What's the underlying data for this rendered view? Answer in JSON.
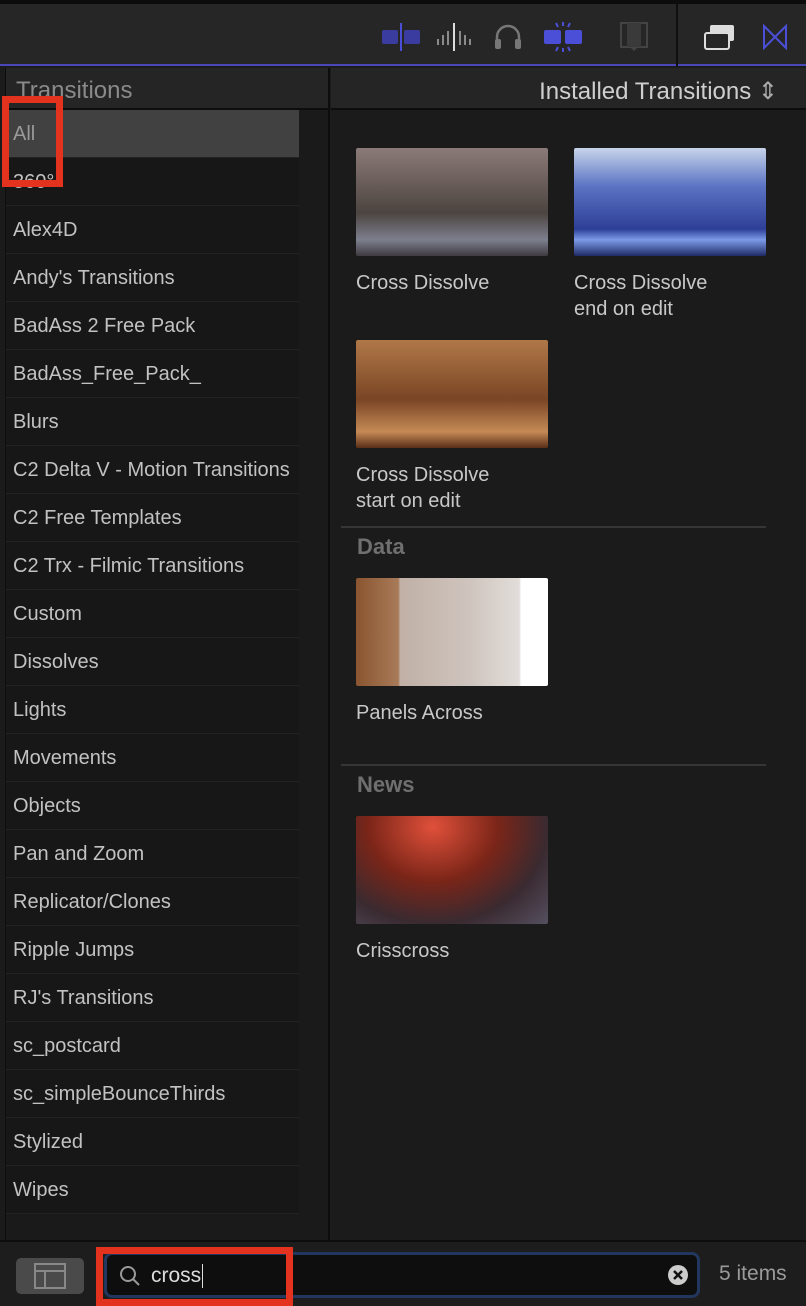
{
  "toolbar": {
    "icons": [
      "clip-connect-icon",
      "audio-waveform-icon",
      "headphones-icon",
      "snapping-icon",
      "filmstrip-icon",
      "window-layout-icon",
      "transitions-browser-icon"
    ],
    "accent": "#4b4fd8"
  },
  "sidebar": {
    "title": "Transitions",
    "items": [
      {
        "label": "All",
        "selected": true
      },
      {
        "label": "360°"
      },
      {
        "label": "Alex4D"
      },
      {
        "label": "Andy's Transitions"
      },
      {
        "label": "BadAss 2 Free Pack"
      },
      {
        "label": "BadAss_Free_Pack_"
      },
      {
        "label": "Blurs"
      },
      {
        "label": "C2 Delta V - Motion Transitions"
      },
      {
        "label": "C2 Free Templates"
      },
      {
        "label": "C2 Trx - Filmic Transitions"
      },
      {
        "label": "Custom"
      },
      {
        "label": "Dissolves"
      },
      {
        "label": "Lights"
      },
      {
        "label": "Movements"
      },
      {
        "label": "Objects"
      },
      {
        "label": "Pan and Zoom"
      },
      {
        "label": "Replicator/Clones"
      },
      {
        "label": "Ripple Jumps"
      },
      {
        "label": "RJ's Transitions"
      },
      {
        "label": "sc_postcard"
      },
      {
        "label": "sc_simpleBounceThirds"
      },
      {
        "label": "Stylized"
      },
      {
        "label": "Wipes"
      }
    ]
  },
  "main": {
    "filter": "Installed Transitions",
    "tiles": [
      {
        "label": "Cross Dissolve"
      },
      {
        "label": "Cross Dissolve end on edit"
      },
      {
        "label": "Cross Dissolve start on edit"
      }
    ],
    "sections": [
      {
        "title": "Data",
        "tiles": [
          {
            "label": "Panels Across"
          }
        ]
      },
      {
        "title": "News",
        "tiles": [
          {
            "label": "Crisscross"
          }
        ]
      }
    ]
  },
  "bottom": {
    "search_value": "cross",
    "count": "5 items"
  }
}
